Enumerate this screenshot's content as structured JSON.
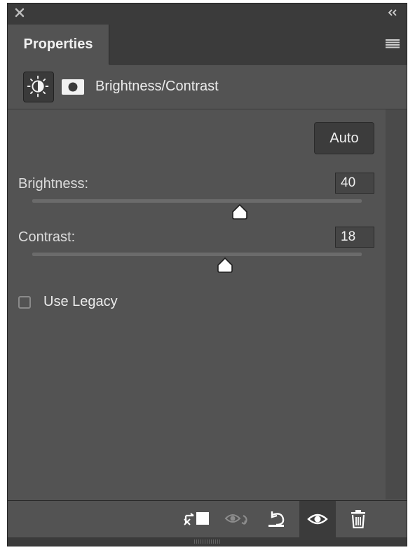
{
  "window": {
    "tab_label": "Properties"
  },
  "header": {
    "title": "Brightness/Contrast",
    "adjustment_icon": "brightness-contrast-icon",
    "mask_icon": "layer-mask-icon"
  },
  "controls": {
    "auto_label": "Auto",
    "brightness": {
      "label": "Brightness:",
      "value": "40",
      "slider_fraction": 0.63
    },
    "contrast": {
      "label": "Contrast:",
      "value": "18",
      "slider_fraction": 0.585
    },
    "legacy": {
      "label": "Use Legacy",
      "checked": false
    }
  },
  "footer": {
    "buttons": [
      {
        "name": "clip-to-layer-icon"
      },
      {
        "name": "view-previous-state-icon"
      },
      {
        "name": "reset-icon"
      },
      {
        "name": "toggle-visibility-icon"
      },
      {
        "name": "delete-icon"
      }
    ]
  },
  "colors": {
    "panel_bg": "#535353",
    "titlebar_bg": "#3b3b3b",
    "text": "#ececec"
  }
}
